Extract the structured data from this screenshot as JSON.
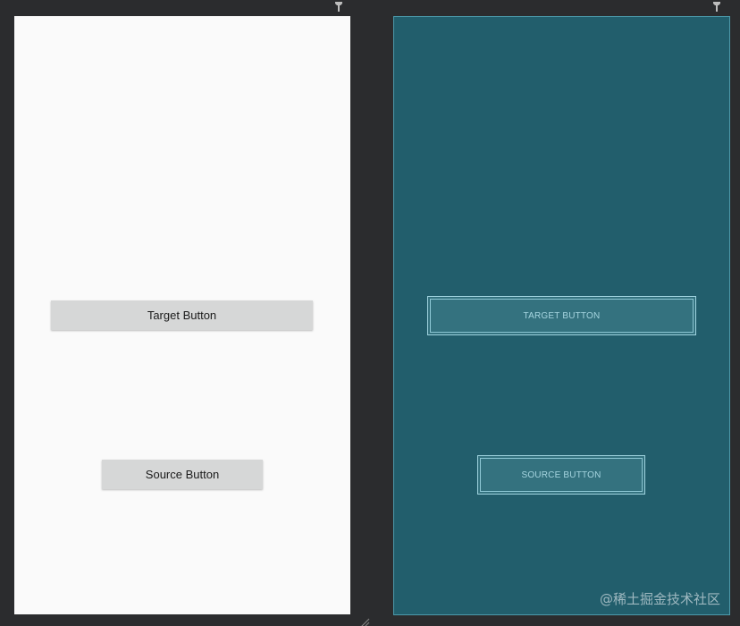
{
  "design_view": {
    "target_button_label": "Target Button",
    "source_button_label": "Source Button",
    "background_color": "#fafafa",
    "button_color": "#d6d7d7"
  },
  "blueprint_view": {
    "target_button_label": "TARGET BUTTON",
    "source_button_label": "SOURCE BUTTON",
    "background_color": "#225e6c",
    "outline_color": "#9fd3df"
  },
  "icons": {
    "pin_left": "pin-icon",
    "pin_right": "pin-icon",
    "resize_handle": "resize-handle-icon"
  },
  "watermark": {
    "text": "@稀土掘金技术社区"
  }
}
